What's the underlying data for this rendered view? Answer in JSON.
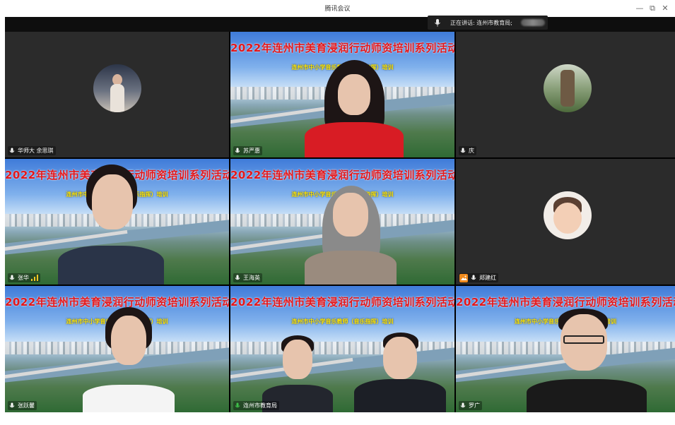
{
  "window": {
    "title": "腾讯会议",
    "minimize": "—",
    "maximize": "⧉",
    "close": "✕"
  },
  "speaking": {
    "label": "正在讲话: 连州市教育局;"
  },
  "banner": {
    "title": "2022年连州市美育浸润行动师资培训系列活动",
    "subtitle": "连州市中小学音乐教师（音乐指挥）培训"
  },
  "participants": [
    {
      "name": "华师大 余思琪",
      "type": "avatar",
      "mic": "on"
    },
    {
      "name": "苏严惠",
      "type": "video",
      "mic": "on"
    },
    {
      "name": "庆",
      "type": "avatar",
      "mic": "on"
    },
    {
      "name": "张华",
      "type": "video",
      "mic": "on",
      "signal": true
    },
    {
      "name": "王海英",
      "type": "video",
      "mic": "on"
    },
    {
      "name": "郑建红",
      "type": "avatar",
      "mic": "on",
      "camera_off_badge": true
    },
    {
      "name": "张跃馨",
      "type": "video",
      "mic": "on"
    },
    {
      "name": "连州市教育局",
      "type": "video",
      "mic": "speaking"
    },
    {
      "name": "罗广",
      "type": "video",
      "mic": "on"
    }
  ],
  "colors": {
    "banner_title": "#e4171a",
    "banner_subtitle": "#ffe600",
    "speaking_mic": "#3fc14a",
    "camera_off_badge": "#f08a1c"
  }
}
